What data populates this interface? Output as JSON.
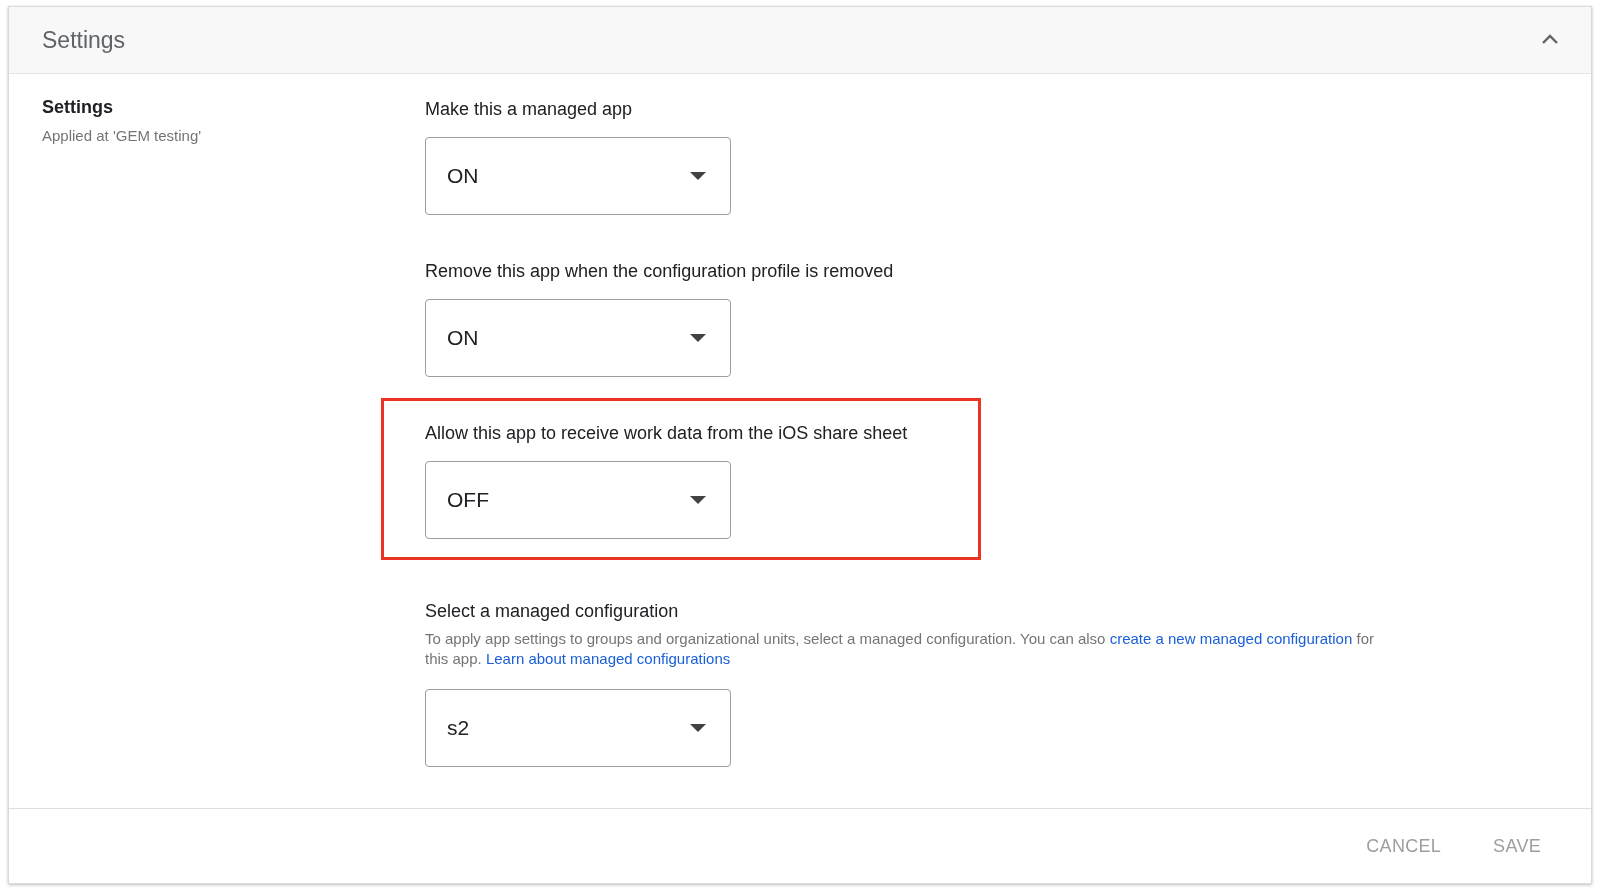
{
  "panel": {
    "title": "Settings",
    "expanded": true
  },
  "summary": {
    "title": "Settings",
    "subtitle": "Applied at 'GEM testing'"
  },
  "settings": [
    {
      "label": "Make this a managed app",
      "value": "ON",
      "highlighted": false
    },
    {
      "label": "Remove this app when the configuration profile is removed",
      "value": "ON",
      "highlighted": false
    },
    {
      "label": "Allow this app to receive work data from the iOS share sheet",
      "value": "OFF",
      "highlighted": true
    },
    {
      "label": "Select a managed configuration",
      "value": "s2",
      "highlighted": false,
      "description": [
        {
          "kind": "text",
          "text": "To apply app settings to groups and organizational units, select a managed configuration. You can also "
        },
        {
          "kind": "link",
          "text": "create a new managed configuration"
        },
        {
          "kind": "text",
          "text": " for this app. "
        },
        {
          "kind": "link",
          "text": "Learn about managed configurations"
        }
      ]
    }
  ],
  "buttons": [
    "CANCEL",
    "SAVE"
  ]
}
